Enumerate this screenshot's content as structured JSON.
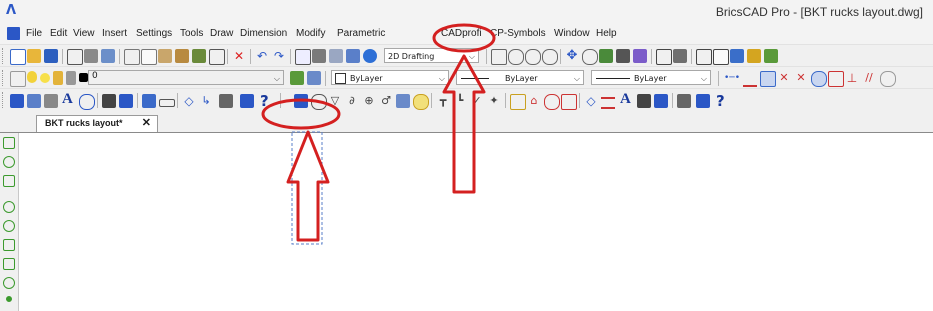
{
  "window": {
    "title": "BricsCAD Pro - [BKT rucks layout.dwg]"
  },
  "menubar": {
    "items": [
      "File",
      "Edit",
      "View",
      "Insert",
      "Settings",
      "Tools",
      "Draw",
      "Dimension",
      "Modify",
      "Parametric",
      "CADprofi",
      "CP-Symbols",
      "Window",
      "Help"
    ]
  },
  "toolbar": {
    "workspace": "2D Drafting",
    "layer": "0",
    "color": "ByLayer",
    "linetype": "ByLayer",
    "lineweight": "ByLayer",
    "text_a": "A",
    "help": "?"
  },
  "tabs": {
    "active": "BKT rucks layout*",
    "close": "✕"
  },
  "annotation": {
    "color": "#d42020"
  }
}
